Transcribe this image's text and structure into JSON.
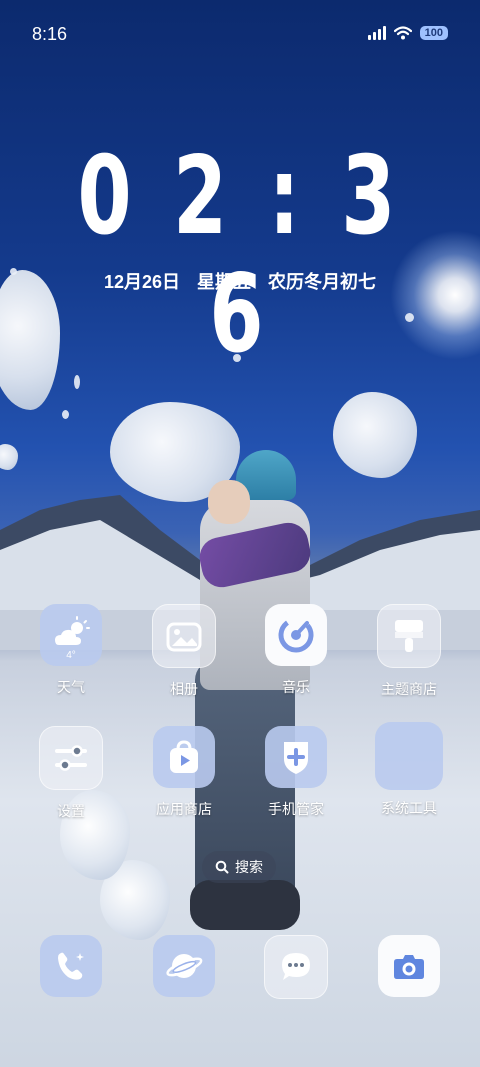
{
  "status_bar": {
    "time": "8:16",
    "battery": "100",
    "icons": [
      "signal-icon",
      "wifi-icon",
      "battery-icon"
    ]
  },
  "clock_widget": {
    "time": "0 2 : 3 6",
    "date": "12月26日",
    "weekday": "星期五",
    "lunar": "农历冬月初七"
  },
  "apps": [
    {
      "label": "天气",
      "icon": "weather-icon",
      "temp": "4°"
    },
    {
      "label": "相册",
      "icon": "gallery-icon"
    },
    {
      "label": "音乐",
      "icon": "music-icon"
    },
    {
      "label": "主题商店",
      "icon": "theme-store-icon"
    },
    {
      "label": "设置",
      "icon": "settings-icon"
    },
    {
      "label": "应用商店",
      "icon": "app-store-icon"
    },
    {
      "label": "手机管家",
      "icon": "phone-manager-icon"
    },
    {
      "label": "系统工具",
      "icon": "folder-icon"
    }
  ],
  "search": {
    "label": "搜索"
  },
  "dock": [
    {
      "icon": "phone-icon"
    },
    {
      "icon": "browser-icon"
    },
    {
      "icon": "messages-icon"
    },
    {
      "icon": "camera-icon"
    }
  ],
  "colors": {
    "sky_top": "#0c2a6e",
    "tile_blue": "#b9caee",
    "accent": "#4b6fd6"
  }
}
